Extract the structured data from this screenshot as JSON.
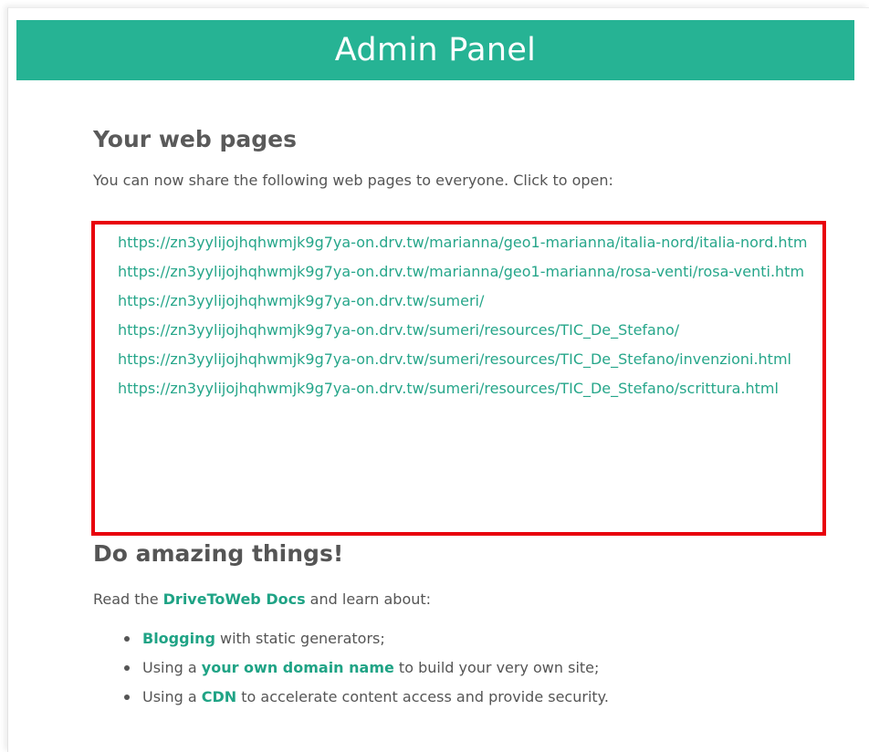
{
  "header": {
    "title": "Admin Panel"
  },
  "web_pages": {
    "title": "Your web pages",
    "intro": "You can now share the following web pages to everyone. Click to open:",
    "links": [
      "https://zn3yylijojhqhwmjk9g7ya-on.drv.tw/marianna/geo1-marianna/italia-nord/italia-nord.htm",
      "https://zn3yylijojhqhwmjk9g7ya-on.drv.tw/marianna/geo1-marianna/rosa-venti/rosa-venti.htm",
      "https://zn3yylijojhqhwmjk9g7ya-on.drv.tw/sumeri/",
      "https://zn3yylijojhqhwmjk9g7ya-on.drv.tw/sumeri/resources/TIC_De_Stefano/",
      "https://zn3yylijojhqhwmjk9g7ya-on.drv.tw/sumeri/resources/TIC_De_Stefano/invenzioni.html",
      "https://zn3yylijojhqhwmjk9g7ya-on.drv.tw/sumeri/resources/TIC_De_Stefano/scrittura.html"
    ],
    "highlight_color": "#e8000b"
  },
  "amazing": {
    "title": "Do amazing things!",
    "docs_prefix": "Read the ",
    "docs_link": "DriveToWeb Docs",
    "docs_suffix": " and learn about:",
    "features": [
      {
        "prefix": "",
        "link": "Blogging",
        "suffix": " with static generators;"
      },
      {
        "prefix": "Using a ",
        "link": "your own domain name",
        "suffix": " to build your very own site;"
      },
      {
        "prefix": "Using a ",
        "link": "CDN",
        "suffix": " to accelerate content access and provide security."
      }
    ]
  },
  "colors": {
    "header_bg": "#26b394",
    "link": "#26a68a",
    "text": "#555555"
  }
}
